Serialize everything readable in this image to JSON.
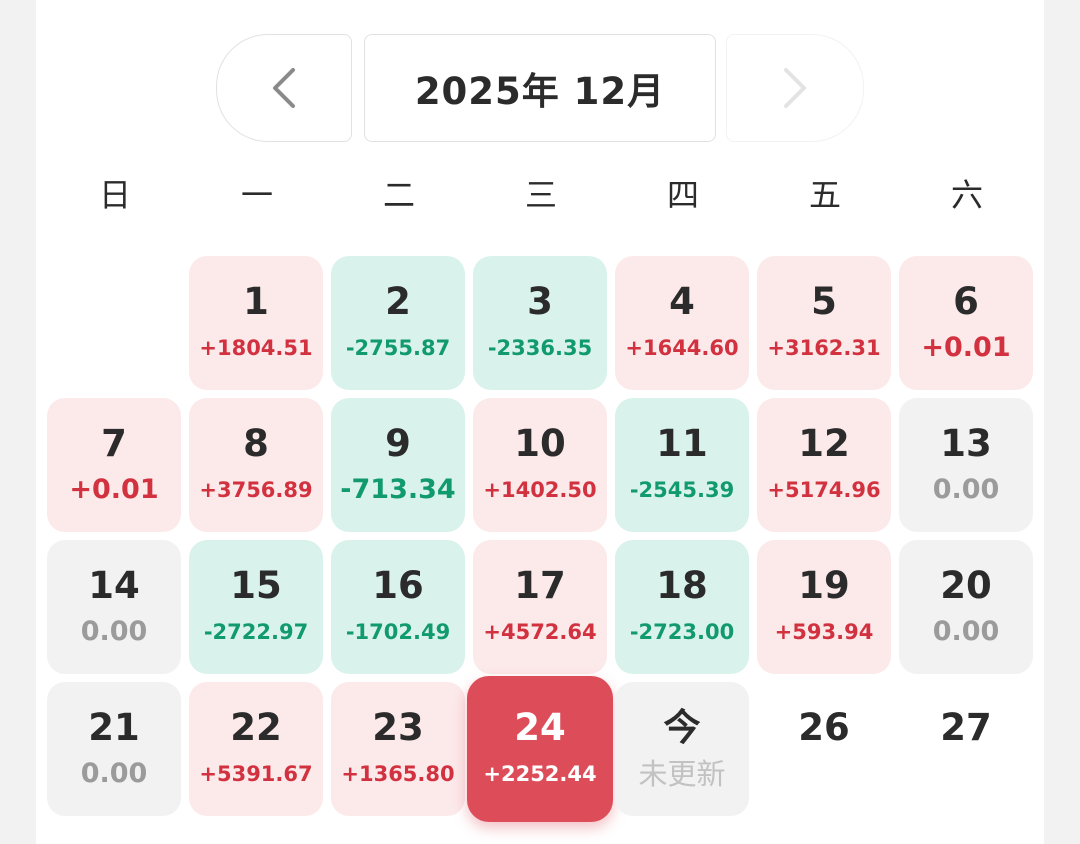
{
  "nav": {
    "month_label": "2025年 12月",
    "prev_icon": "chevron-left-icon",
    "next_icon": "chevron-right-icon"
  },
  "weekdays": [
    "日",
    "一",
    "二",
    "三",
    "四",
    "五",
    "六"
  ],
  "colors": {
    "positive_bg": "#fce9ea",
    "positive_text": "#d2323f",
    "negative_bg": "#d9f3ec",
    "negative_text": "#129a6f",
    "neutral_bg": "#f2f2f2",
    "selected_bg": "#dd4d59"
  },
  "days": [
    {
      "day": "1",
      "value": "+1804.51",
      "kind": "pos"
    },
    {
      "day": "2",
      "value": "-2755.87",
      "kind": "neg"
    },
    {
      "day": "3",
      "value": "-2336.35",
      "kind": "neg"
    },
    {
      "day": "4",
      "value": "+1644.60",
      "kind": "pos"
    },
    {
      "day": "5",
      "value": "+3162.31",
      "kind": "pos"
    },
    {
      "day": "6",
      "value": "+0.01",
      "kind": "pos",
      "big": true
    },
    {
      "day": "7",
      "value": "+0.01",
      "kind": "pos",
      "big": true
    },
    {
      "day": "8",
      "value": "+3756.89",
      "kind": "pos"
    },
    {
      "day": "9",
      "value": "-713.34",
      "kind": "neg",
      "big": true
    },
    {
      "day": "10",
      "value": "+1402.50",
      "kind": "pos"
    },
    {
      "day": "11",
      "value": "-2545.39",
      "kind": "neg"
    },
    {
      "day": "12",
      "value": "+5174.96",
      "kind": "pos"
    },
    {
      "day": "13",
      "value": "0.00",
      "kind": "zero"
    },
    {
      "day": "14",
      "value": "0.00",
      "kind": "zero"
    },
    {
      "day": "15",
      "value": "-2722.97",
      "kind": "neg"
    },
    {
      "day": "16",
      "value": "-1702.49",
      "kind": "neg"
    },
    {
      "day": "17",
      "value": "+4572.64",
      "kind": "pos"
    },
    {
      "day": "18",
      "value": "-2723.00",
      "kind": "neg"
    },
    {
      "day": "19",
      "value": "+593.94",
      "kind": "pos"
    },
    {
      "day": "20",
      "value": "0.00",
      "kind": "zero"
    },
    {
      "day": "21",
      "value": "0.00",
      "kind": "zero"
    },
    {
      "day": "22",
      "value": "+5391.67",
      "kind": "pos"
    },
    {
      "day": "23",
      "value": "+1365.80",
      "kind": "pos"
    },
    {
      "day": "24",
      "value": "+2252.44",
      "kind": "sel"
    },
    {
      "day": "今",
      "value": "未更新",
      "kind": "today"
    },
    {
      "day": "26",
      "value": "",
      "kind": "blank"
    },
    {
      "day": "27",
      "value": "",
      "kind": "blank"
    }
  ]
}
